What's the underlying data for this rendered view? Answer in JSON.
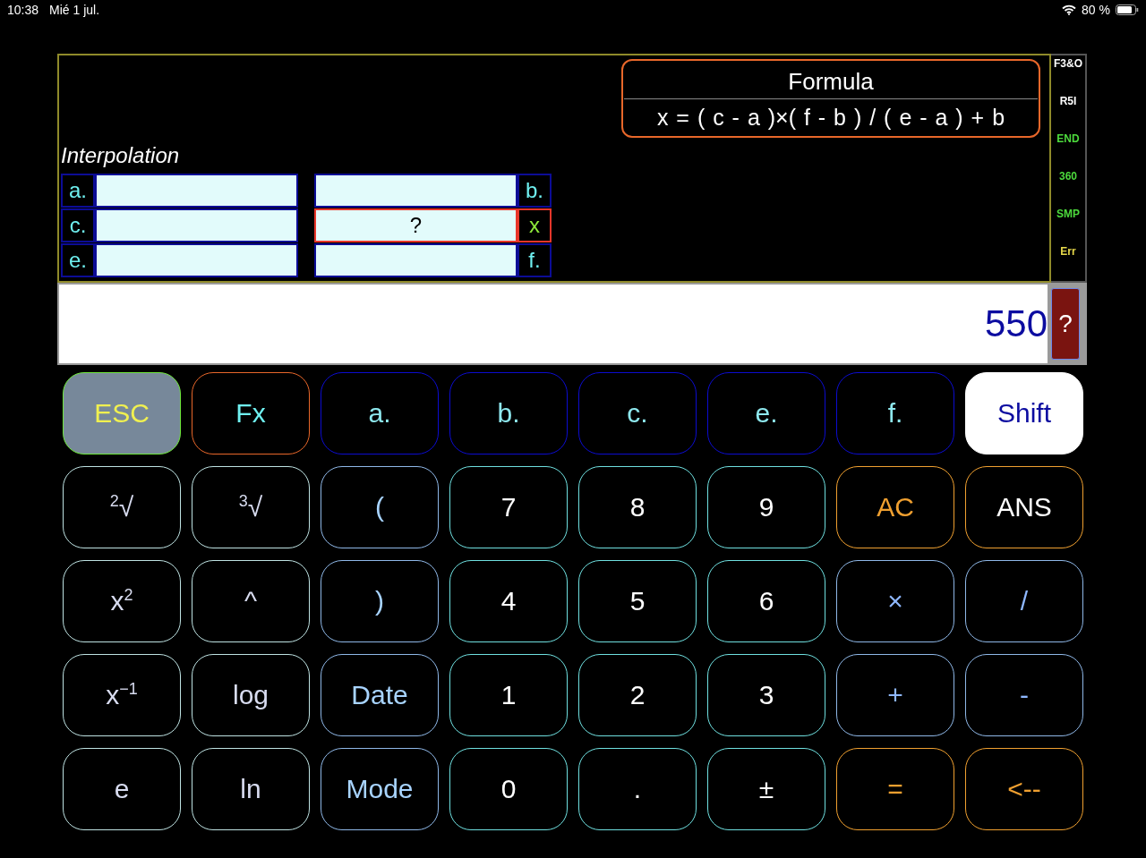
{
  "status_bar": {
    "time": "10:38",
    "date": "Mié 1 jul.",
    "battery": "80 %"
  },
  "panel": {
    "title": "Interpolation",
    "formula": {
      "title": "Formula",
      "expression": "x = ( c - a )×( f - b ) / ( e - a ) + b"
    },
    "rows": [
      {
        "left": {
          "label": "a.",
          "selected": false
        },
        "right": {
          "label": "b.",
          "selected": false
        }
      },
      {
        "left": {
          "label": "c.",
          "selected": false
        },
        "right": {
          "label": "x",
          "value": "?",
          "selected": true
        }
      },
      {
        "left": {
          "label": "e.",
          "selected": false
        },
        "right": {
          "label": "f.",
          "selected": false
        }
      }
    ]
  },
  "indicators": [
    {
      "text": "F3&O",
      "color": "#ffffff"
    },
    {
      "text": "R5I",
      "color": "#ffffff"
    },
    {
      "text": "END",
      "color": "#4cd93c"
    },
    {
      "text": "360",
      "color": "#4cd93c"
    },
    {
      "text": "SMP",
      "color": "#4cd93c"
    },
    {
      "text": "Err",
      "color": "#e6d84a"
    }
  ],
  "display": {
    "value": "550",
    "help_button": "?"
  },
  "keys": [
    {
      "label": "ESC",
      "kind": "esc"
    },
    {
      "label": "Fx",
      "kind": "fx"
    },
    {
      "label": "a.",
      "kind": "var"
    },
    {
      "label": "b.",
      "kind": "var"
    },
    {
      "label": "c.",
      "kind": "var"
    },
    {
      "label": "e.",
      "kind": "var"
    },
    {
      "label": "f.",
      "kind": "var"
    },
    {
      "label": "Shift",
      "kind": "shift"
    },
    {
      "label": "$^{2}$√",
      "kind": "func"
    },
    {
      "label": "$^{3}$√",
      "kind": "func"
    },
    {
      "label": "(",
      "kind": "paren"
    },
    {
      "label": "7",
      "kind": "digit"
    },
    {
      "label": "8",
      "kind": "digit"
    },
    {
      "label": "9",
      "kind": "digit"
    },
    {
      "label": "AC",
      "kind": "clear"
    },
    {
      "label": "ANS",
      "kind": "ans"
    },
    {
      "label": "x$^{2}$",
      "kind": "func"
    },
    {
      "label": "^",
      "kind": "func"
    },
    {
      "label": ")",
      "kind": "paren"
    },
    {
      "label": "4",
      "kind": "digit"
    },
    {
      "label": "5",
      "kind": "digit"
    },
    {
      "label": "6",
      "kind": "digit"
    },
    {
      "label": "×",
      "kind": "op"
    },
    {
      "label": "/",
      "kind": "op"
    },
    {
      "label": "x$^{−1}$",
      "kind": "func"
    },
    {
      "label": "log",
      "kind": "func"
    },
    {
      "label": "Date",
      "kind": "paren"
    },
    {
      "label": "1",
      "kind": "digit"
    },
    {
      "label": "2",
      "kind": "digit"
    },
    {
      "label": "3",
      "kind": "digit"
    },
    {
      "label": "+",
      "kind": "op"
    },
    {
      "label": "-",
      "kind": "op"
    },
    {
      "label": "e",
      "kind": "func"
    },
    {
      "label": "ln",
      "kind": "func"
    },
    {
      "label": "Mode",
      "kind": "paren"
    },
    {
      "label": "0",
      "kind": "digit"
    },
    {
      "label": ".",
      "kind": "digit"
    },
    {
      "label": "±",
      "kind": "digit"
    },
    {
      "label": "=",
      "kind": "clear"
    },
    {
      "label": "<--",
      "kind": "clear"
    }
  ]
}
